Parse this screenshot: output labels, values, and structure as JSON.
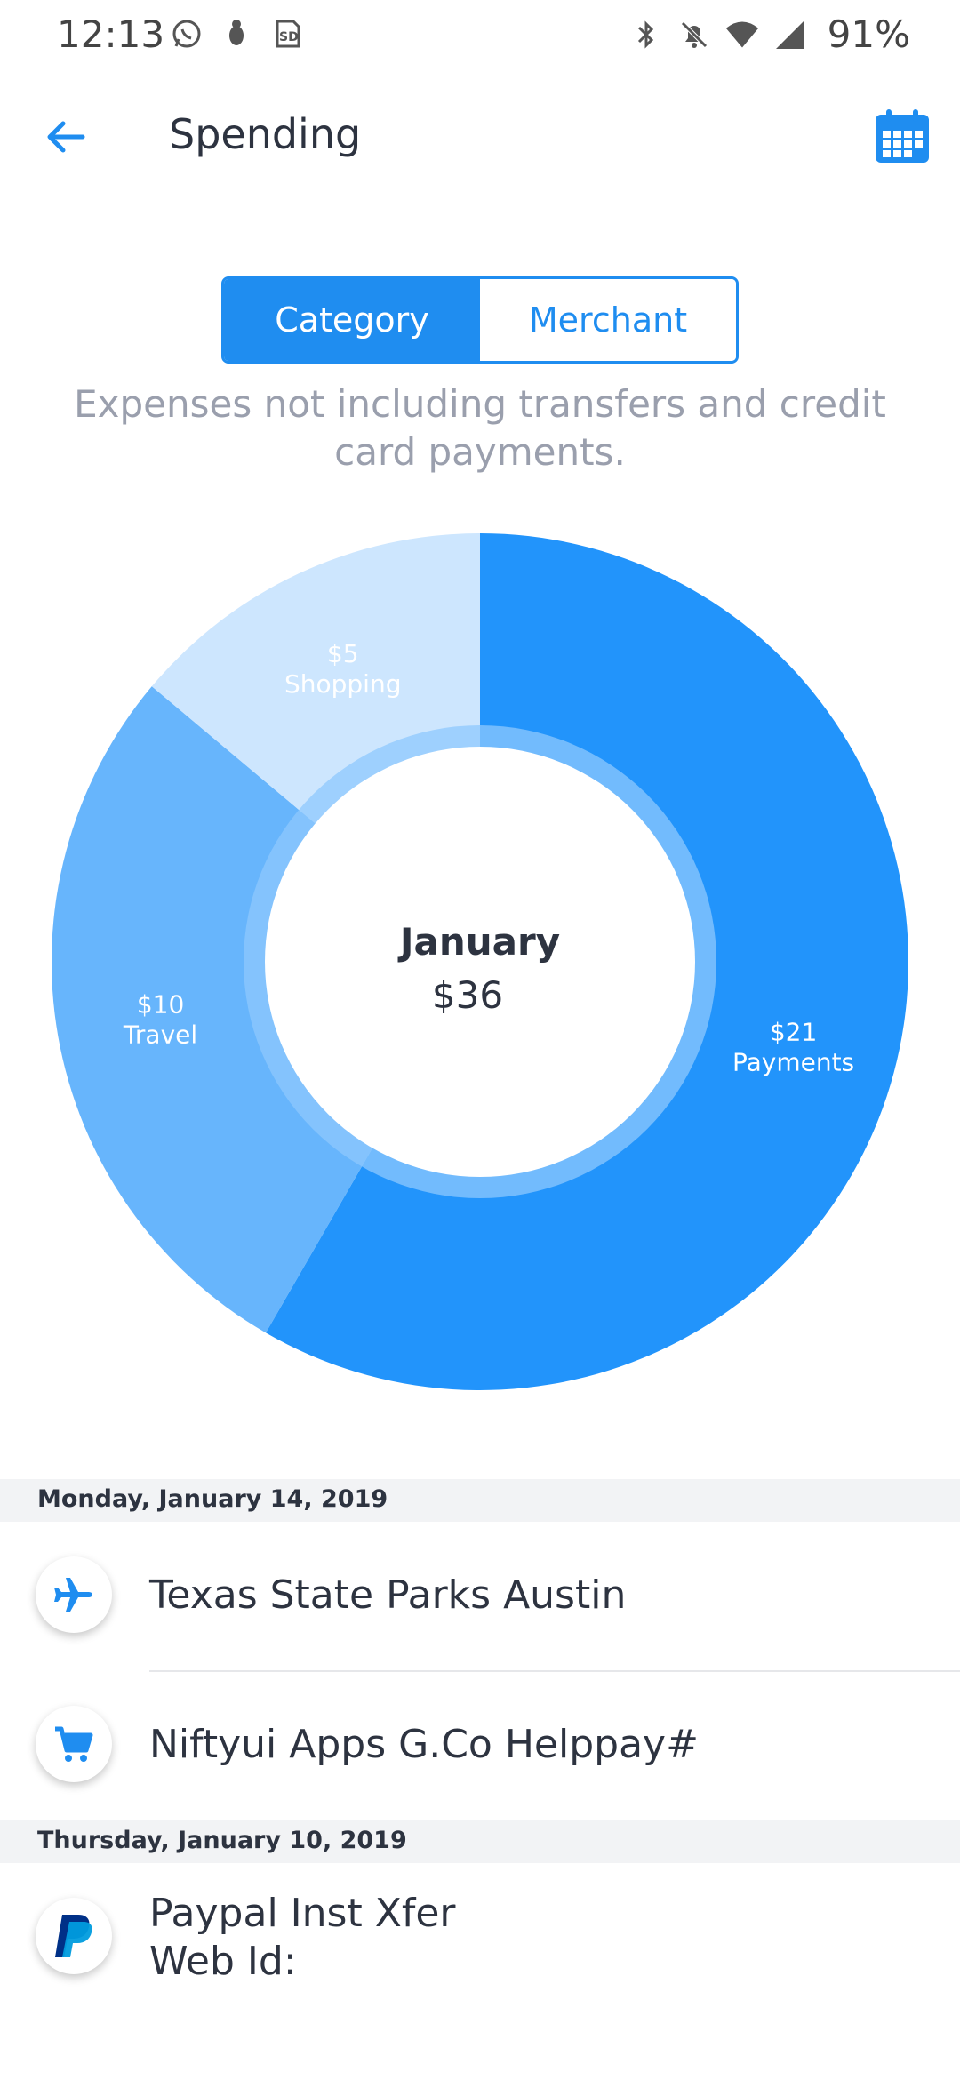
{
  "status_bar": {
    "time": "12:13",
    "battery": "91%",
    "left_icons": [
      "whatsapp-icon",
      "android-debug-icon",
      "sd-card-icon"
    ],
    "right_icons": [
      "bluetooth-icon",
      "notifications-off-icon",
      "wifi-icon",
      "cell-signal-icon"
    ]
  },
  "app_bar": {
    "title": "Spending",
    "back_icon": "arrow-left-icon",
    "calendar_icon": "calendar-icon"
  },
  "segmented": {
    "category_label": "Category",
    "merchant_label": "Merchant",
    "selected": "Category"
  },
  "subtitle": "Expenses not including transfers and credit card payments.",
  "chart_data": {
    "type": "pie",
    "center_title": "January",
    "center_value": "$36",
    "slices": [
      {
        "label": "Payments",
        "display_value": "$21",
        "value": 21,
        "color": "#2294fb"
      },
      {
        "label": "Travel",
        "display_value": "$10",
        "value": 10,
        "color": "#67b5fc"
      },
      {
        "label": "Shopping",
        "display_value": "$5",
        "value": 5,
        "color": "#cde6fe"
      }
    ],
    "inner_ring_color": "#8ec8fd"
  },
  "transactions": [
    {
      "date_header": "Monday, January 14, 2019",
      "items": [
        {
          "name": "Texas State Parks Austin",
          "icon": "airplane-icon"
        },
        {
          "name": "Niftyui Apps G.Co Helppay#",
          "icon": "shopping-cart-icon"
        }
      ]
    },
    {
      "date_header": "Thursday, January 10, 2019",
      "items": [
        {
          "name": "Paypal Inst Xfer\nWeb Id:",
          "icon": "paypal-icon"
        }
      ]
    }
  ],
  "colors": {
    "accent": "#1f8df0",
    "text": "#2d3340",
    "muted": "#9a9fad"
  }
}
